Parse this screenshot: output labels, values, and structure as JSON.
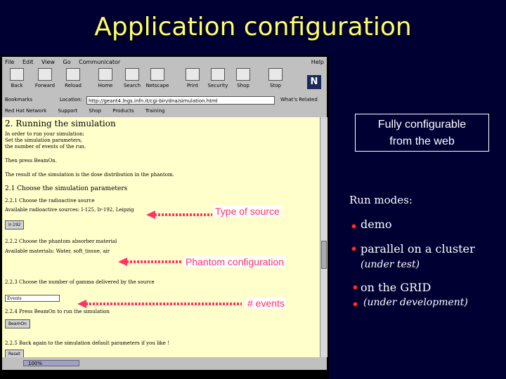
{
  "slide": {
    "title": "Application configuration"
  },
  "browser": {
    "menu": [
      "File",
      "Edit",
      "View",
      "Go",
      "Communicator"
    ],
    "menu_help": "Help",
    "toolbar": [
      "Back",
      "Forward",
      "Reload",
      "Home",
      "Search",
      "Netscape",
      "Print",
      "Security",
      "Shop",
      "Stop"
    ],
    "bookmarks_label": "Bookmarks",
    "location_label": "Location:",
    "location_value": "http://geant4.lngs.infn.it/cgi-bin/dna/simulation.html",
    "whats_related": "What's Related",
    "personal_bar": [
      "Red Hat Network",
      "Support",
      "Shop",
      "Products",
      "Training"
    ],
    "logo": "N",
    "zoom": "100%"
  },
  "page": {
    "heading": "2. Running the simulation",
    "intro": [
      "In order to run your simulation:",
      "Set the simulation parameters,",
      "the number of events of the run."
    ],
    "beamon_hint": "Then press BeamOn.",
    "result_text": "The result of the simulation is the dose distribution in the phantom.",
    "section": "2.1 Choose the simulation parameters",
    "step1": "2.2.1 Choose the radioactive source",
    "sources_text": "Available radioactive sources: I-125, Ir-192, Leipzig",
    "btn_source": "Ir-192",
    "step2": "2.2.2 Choose the phantom absorber material",
    "materials_text": "Available materials: Water, soft_tissue, air",
    "step3": "2.2.3 Choose the number of gamma delivered by the source",
    "events_value": "Events",
    "step4": "2.2.4 Press BeamOn to run the simulation",
    "btn_beamon": "BeamOn",
    "step5": "2.2.5 Back again to the simulation default parameters if you like !",
    "btn_reset": "Reset"
  },
  "callouts": {
    "box": [
      "Fully configurable",
      "from the web"
    ],
    "source": "Type of source",
    "phantom": "Phantom configuration",
    "events": "# events"
  },
  "modes": {
    "title": "Run modes:",
    "items": [
      "demo",
      "parallel on a cluster",
      "on the GRID"
    ],
    "cluster_note": "(under test)",
    "grid_note": "(under development)"
  },
  "colors": {
    "title": "#ffff66",
    "background": "#000033",
    "annotation": "#ff3366",
    "page": "#ffffcc"
  }
}
